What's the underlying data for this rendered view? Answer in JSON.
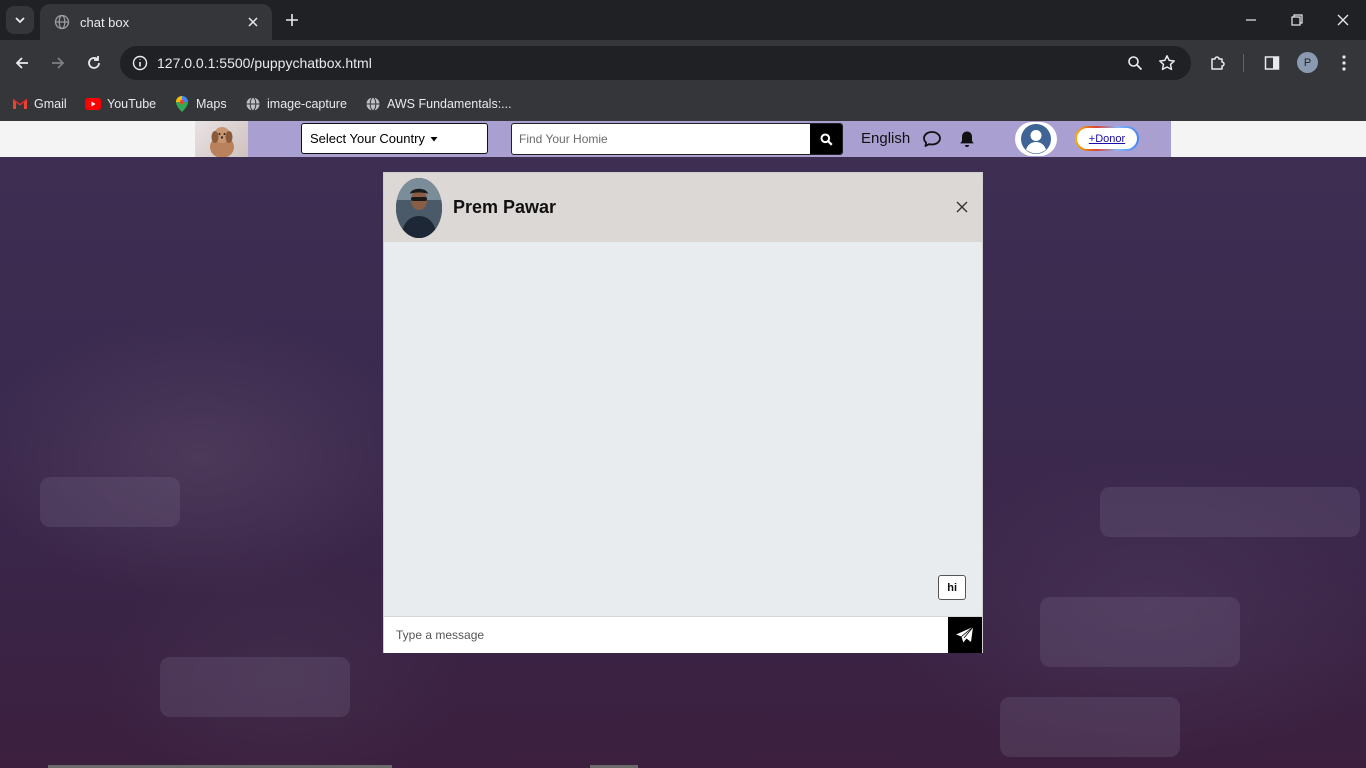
{
  "browser": {
    "tab_title": "chat box",
    "url_host": "127.0.0.1",
    "url_path": ":5500/puppychatbox.html",
    "profile_initial": "P",
    "bookmarks": [
      {
        "label": "Gmail",
        "icon": "gmail-icon"
      },
      {
        "label": "YouTube",
        "icon": "youtube-icon"
      },
      {
        "label": "Maps",
        "icon": "maps-icon"
      },
      {
        "label": "image-capture",
        "icon": "globe-icon"
      },
      {
        "label": "AWS Fundamentals:...",
        "icon": "globe-icon"
      }
    ]
  },
  "navbar": {
    "country_label": "Select Your Country",
    "search_placeholder": "Find Your Homie",
    "language": "English",
    "donor_label": "+Donor"
  },
  "chat": {
    "contact_name": "Prem Pawar",
    "messages": [
      {
        "text": "hi",
        "from": "me"
      }
    ],
    "input_placeholder": "Type a message"
  },
  "colors": {
    "navbar_bg": "#a99fd0",
    "page_bg": "#3b2a4f",
    "chat_bg": "#e9ecee",
    "chat_header_bg": "#dcd8d6"
  }
}
